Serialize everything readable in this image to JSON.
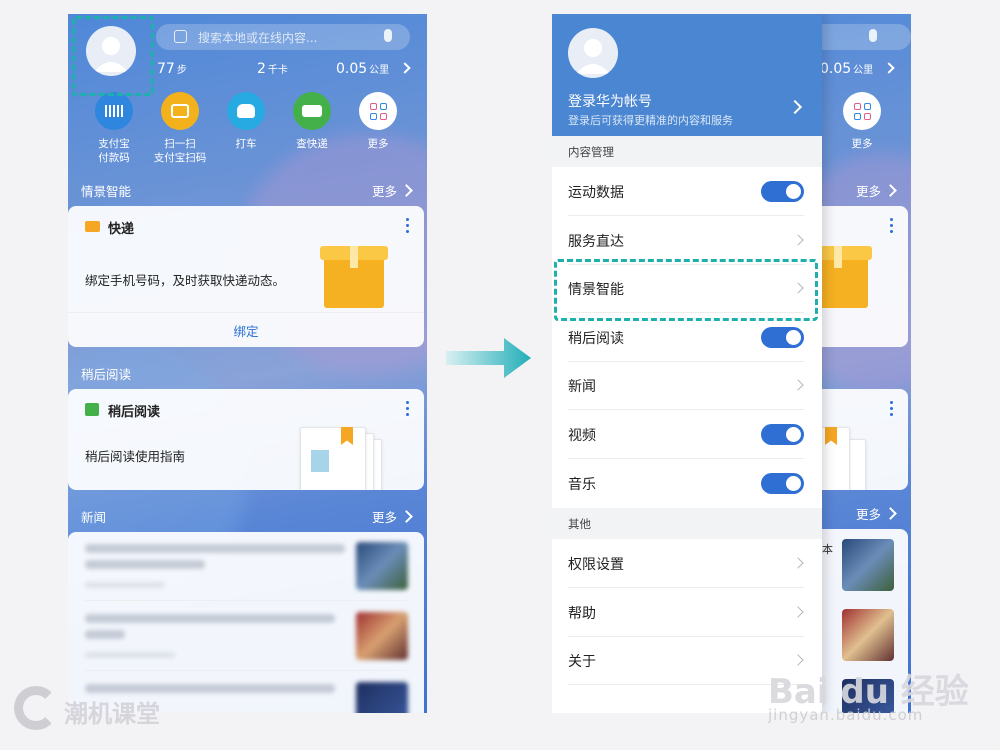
{
  "colors": {
    "accent": "#2b6fd6",
    "toggle_on": "#2f6fd4",
    "highlight": "#1eb0ad",
    "arrow": "#22aeb8"
  },
  "left": {
    "search": {
      "placeholder": "搜索本地或在线内容..."
    },
    "stats": {
      "steps_value": "77",
      "steps_unit": "步",
      "kcal_value": "2",
      "kcal_unit": "千卡",
      "km_value": "0.05",
      "km_unit": "公里"
    },
    "quick_actions": [
      {
        "label": "支付宝\n付款码",
        "icon": "barcode-icon",
        "color": "#2e86de"
      },
      {
        "label": "扫一扫\n支付宝扫码",
        "icon": "scan-icon",
        "color": "#f3b21c"
      },
      {
        "label": "打车",
        "icon": "taxi-icon",
        "color": "#27a9e1"
      },
      {
        "label": "查快递",
        "icon": "truck-icon",
        "color": "#43b04a"
      },
      {
        "label": "更多",
        "icon": "grid-icon",
        "color": "#ffffff"
      }
    ],
    "sections": {
      "smart": "情景智能",
      "smart_more": "更多",
      "later": "稍后阅读",
      "news": "新闻",
      "news_more": "更多"
    },
    "express_card": {
      "title": "快递",
      "text": "绑定手机号码，及时获取快递动态。",
      "action": "绑定"
    },
    "later_card": {
      "title": "稍后阅读",
      "text": "稍后阅读使用指南"
    }
  },
  "right": {
    "account": {
      "title": "登录华为帐号",
      "subtitle": "登录后可获得更精准的内容和服务"
    },
    "groups": {
      "content": "内容管理",
      "other": "其他"
    },
    "bg": {
      "km_value": "0.05",
      "km_unit": "公里",
      "more1": "更多",
      "more2": "更多",
      "more3": "更多",
      "news_char": "本"
    },
    "items": [
      {
        "label": "运动数据",
        "control": "toggle",
        "on": true
      },
      {
        "label": "服务直达",
        "control": "chevron"
      },
      {
        "label": "情景智能",
        "control": "chevron"
      },
      {
        "label": "稍后阅读",
        "control": "toggle",
        "on": true
      },
      {
        "label": "新闻",
        "control": "chevron"
      },
      {
        "label": "视频",
        "control": "toggle",
        "on": true
      },
      {
        "label": "音乐",
        "control": "toggle",
        "on": true
      }
    ],
    "other_items": [
      {
        "label": "权限设置"
      },
      {
        "label": "帮助"
      },
      {
        "label": "关于"
      }
    ]
  },
  "watermarks": {
    "left_logo": "潮机课堂",
    "baidu": "Bai du 经验",
    "baidu_url": "jingyan.baidu.com"
  }
}
